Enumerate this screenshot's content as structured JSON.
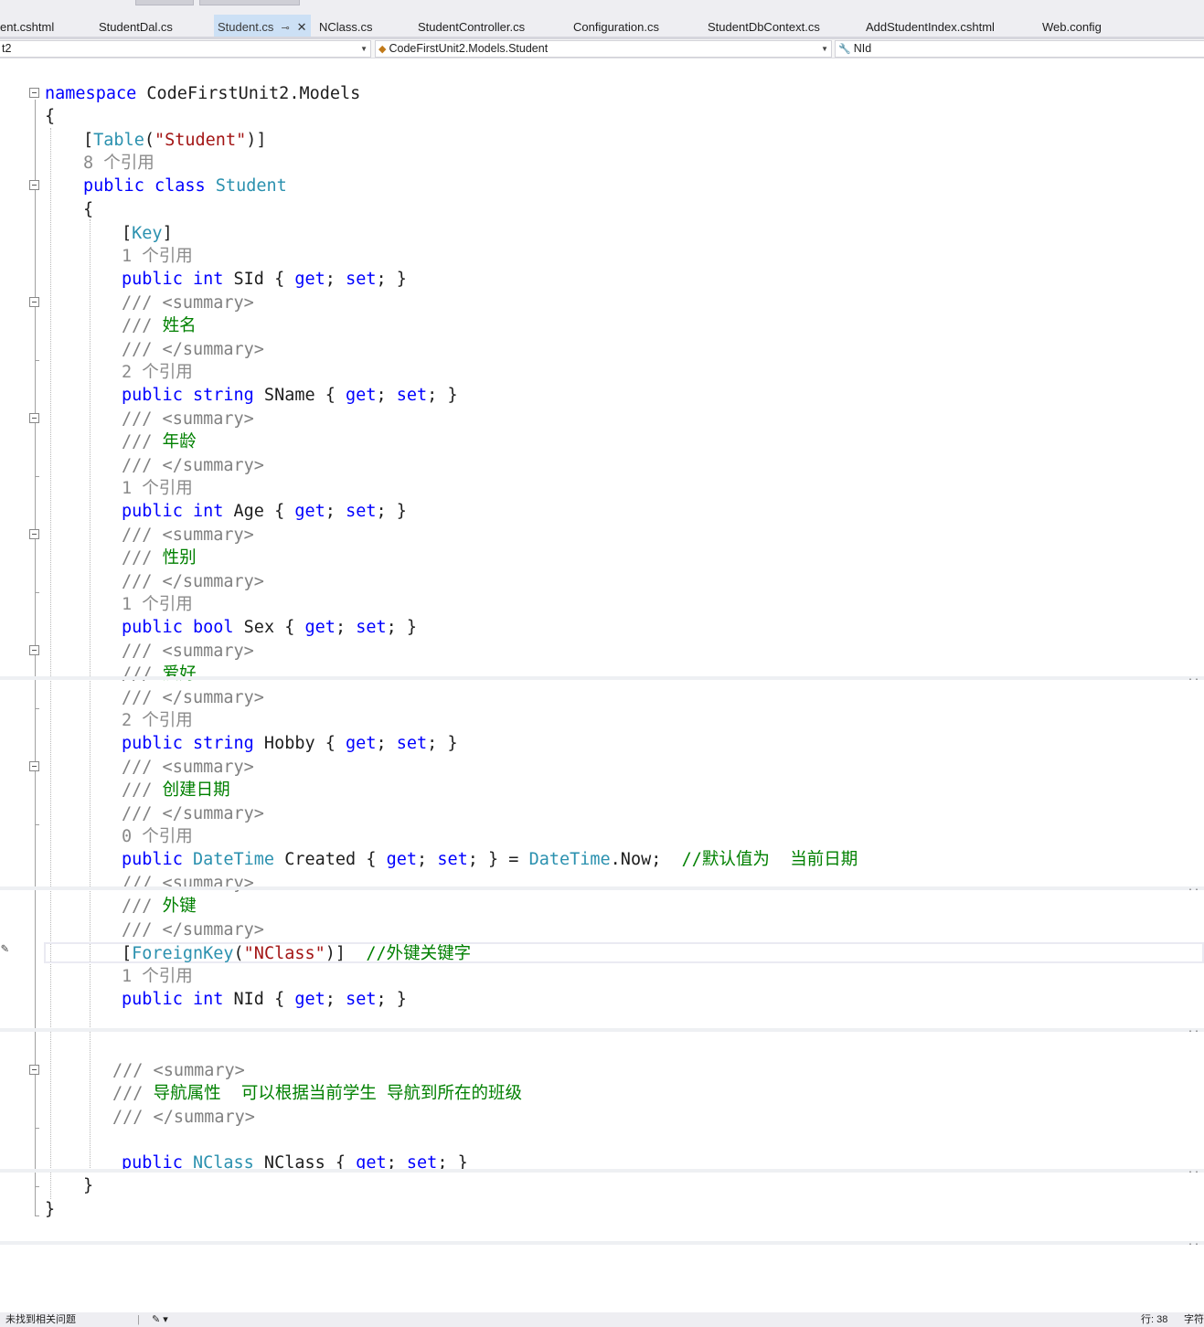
{
  "tabs": [
    {
      "label": "ent.cshtml",
      "active": false
    },
    {
      "label": "StudentDal.cs",
      "active": false
    },
    {
      "label": "Student.cs",
      "active": true
    },
    {
      "label": "NClass.cs",
      "active": false
    },
    {
      "label": "StudentController.cs",
      "active": false
    },
    {
      "label": "Configuration.cs",
      "active": false
    },
    {
      "label": "StudentDbContext.cs",
      "active": false
    },
    {
      "label": "AddStudentIndex.cshtml",
      "active": false
    },
    {
      "label": "Web.config",
      "active": false
    }
  ],
  "tab_icons": {
    "pin": "pin-icon",
    "close": "close-icon"
  },
  "nav": {
    "project": "t2",
    "type": "CodeFirstUnit2.Models.Student",
    "member": "NId",
    "type_icon": "class-icon",
    "member_icon": "wrench-icon"
  },
  "code": {
    "l1": {
      "kw": "namespace",
      "name": " CodeFirstUnit2.Models"
    },
    "l2": "{",
    "l3": {
      "open": "[",
      "type": "Table",
      "paren_open": "(",
      "str": "\"Student\"",
      "close": ")]"
    },
    "l4": "8 个引用",
    "l5": {
      "kw": "public class",
      "type": " Student"
    },
    "l6": "{",
    "l7": {
      "open": "[",
      "type": "Key",
      "close": "]"
    },
    "l8": "1 个引用",
    "l9": {
      "kw": "public int",
      "name": " SId ",
      "b1": "{ ",
      "get": "get",
      "s1": "; ",
      "set": "set",
      "b2": "; }"
    },
    "l10": {
      "xml": "/// <summary>"
    },
    "l11": {
      "xml": "/// ",
      "text": "姓名"
    },
    "l12": {
      "xml": "/// </summary>"
    },
    "l13": "2 个引用",
    "l14": {
      "kw": "public string",
      "name": " SName ",
      "b1": "{ ",
      "get": "get",
      "s1": "; ",
      "set": "set",
      "b2": "; }"
    },
    "l15": {
      "xml": "/// <summary>"
    },
    "l16": {
      "xml": "/// ",
      "text": "年龄"
    },
    "l17": {
      "xml": "/// </summary>"
    },
    "l18": "1 个引用",
    "l19": {
      "kw": "public int",
      "name": " Age ",
      "b1": "{ ",
      "get": "get",
      "s1": "; ",
      "set": "set",
      "b2": "; }"
    },
    "l20": {
      "xml": "/// <summary>"
    },
    "l21": {
      "xml": "/// ",
      "text": "性别"
    },
    "l22": {
      "xml": "/// </summary>"
    },
    "l23": "1 个引用",
    "l24": {
      "kw": "public bool",
      "name": " Sex ",
      "b1": "{ ",
      "get": "get",
      "s1": "; ",
      "set": "set",
      "b2": "; }"
    },
    "l25": {
      "xml": "/// <summary>"
    },
    "l26": {
      "xml": "/// ",
      "text": "爱好"
    },
    "l27": {
      "xml": "/// </summary>"
    },
    "l28": "2 个引用",
    "l29": {
      "kw": "public string",
      "name": " Hobby ",
      "b1": "{ ",
      "get": "get",
      "s1": "; ",
      "set": "set",
      "b2": "; }"
    },
    "l30": {
      "xml": "/// <summary>"
    },
    "l31": {
      "xml": "/// ",
      "text": "创建日期"
    },
    "l32": {
      "xml": "/// </summary>"
    },
    "l33": "0 个引用",
    "l34": {
      "kw": "public",
      "type": " DateTime",
      "name": " Created ",
      "b1": "{ ",
      "get": "get",
      "s1": "; ",
      "set": "set",
      "b2": "; } = ",
      "type2": "DateTime",
      "tail": ".Now;  ",
      "comment": "//默认值为  当前日期"
    },
    "l35": {
      "xml": "/// <summary>"
    },
    "l36": {
      "xml": "/// ",
      "text": "外键"
    },
    "l37": {
      "xml": "/// </summary>"
    },
    "l38": {
      "open": "[",
      "type": "ForeignKey",
      "paren_open": "(",
      "str": "\"NClass\"",
      "close": ")]  ",
      "comment": "//外键关键字"
    },
    "l39": "1 个引用",
    "l40": {
      "kw": "public int",
      "name": " NId ",
      "b1": "{ ",
      "get": "get",
      "s1": "; ",
      "set": "set",
      "b2": "; }"
    },
    "l41": {
      "xml": "/// <summary>"
    },
    "l42": {
      "xml": "/// ",
      "text": "导航属性  可以根据当前学生 导航到所在的班级"
    },
    "l43": {
      "xml": "/// </summary>"
    },
    "l44": {
      "kw": "public",
      "type": " NClass",
      "name": " NClass ",
      "b1": "{ ",
      "get": "get",
      "s1": "; ",
      "set": "set",
      "b2": "; }"
    },
    "l45": "}",
    "l46": "}"
  },
  "status": {
    "message": "未找到相关问题",
    "line_label": "行: 38",
    "char_label": "字符"
  },
  "colors": {
    "keyword": "#0000ff",
    "type": "#2b91af",
    "string": "#a31515",
    "comment": "#008000",
    "xmldoc": "#808080",
    "active_tab": "#cce0f5"
  }
}
